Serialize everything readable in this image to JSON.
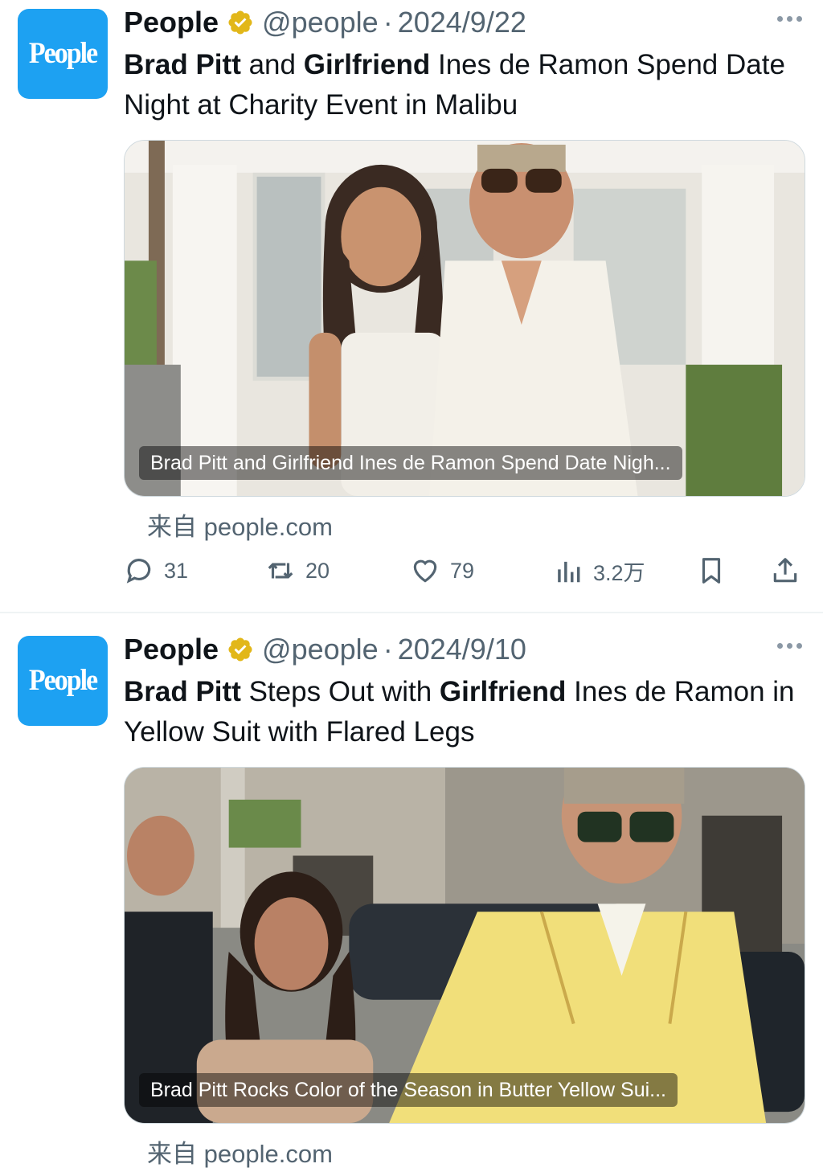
{
  "tweets": [
    {
      "avatar_text": "People",
      "name": "People",
      "handle": "@people",
      "separator": "·",
      "date": "2024/9/22",
      "text_parts": [
        {
          "t": "Brad Pitt",
          "b": true
        },
        {
          "t": " and ",
          "b": false
        },
        {
          "t": "Girlfriend",
          "b": true
        },
        {
          "t": " Ines de Ramon Spend Date Night at Charity Event in Malibu",
          "b": false
        }
      ],
      "media_caption": "Brad Pitt and Girlfriend Ines de Ramon Spend Date Nigh...",
      "source_prefix": "来自",
      "source_domain": "people.com",
      "replies": "31",
      "retweets": "20",
      "likes": "79",
      "views": "3.2万"
    },
    {
      "avatar_text": "People",
      "name": "People",
      "handle": "@people",
      "separator": "·",
      "date": "2024/9/10",
      "text_parts": [
        {
          "t": "Brad Pitt",
          "b": true
        },
        {
          "t": " Steps Out with ",
          "b": false
        },
        {
          "t": "Girlfriend",
          "b": true
        },
        {
          "t": " Ines de Ramon in Yellow Suit with Flared Legs",
          "b": false
        }
      ],
      "media_caption": "Brad Pitt Rocks Color of the Season in Butter Yellow Sui...",
      "source_prefix": "来自",
      "source_domain": "people.com"
    }
  ],
  "icons": {
    "verified": "verified-badge-icon",
    "more": "more-icon",
    "reply": "reply-icon",
    "retweet": "retweet-icon",
    "like": "heart-icon",
    "views": "views-icon",
    "bookmark": "bookmark-icon",
    "share": "share-icon"
  },
  "colors": {
    "avatar_bg": "#1da1f2",
    "verified_gold": "#e2b719",
    "secondary_text": "#536471"
  }
}
